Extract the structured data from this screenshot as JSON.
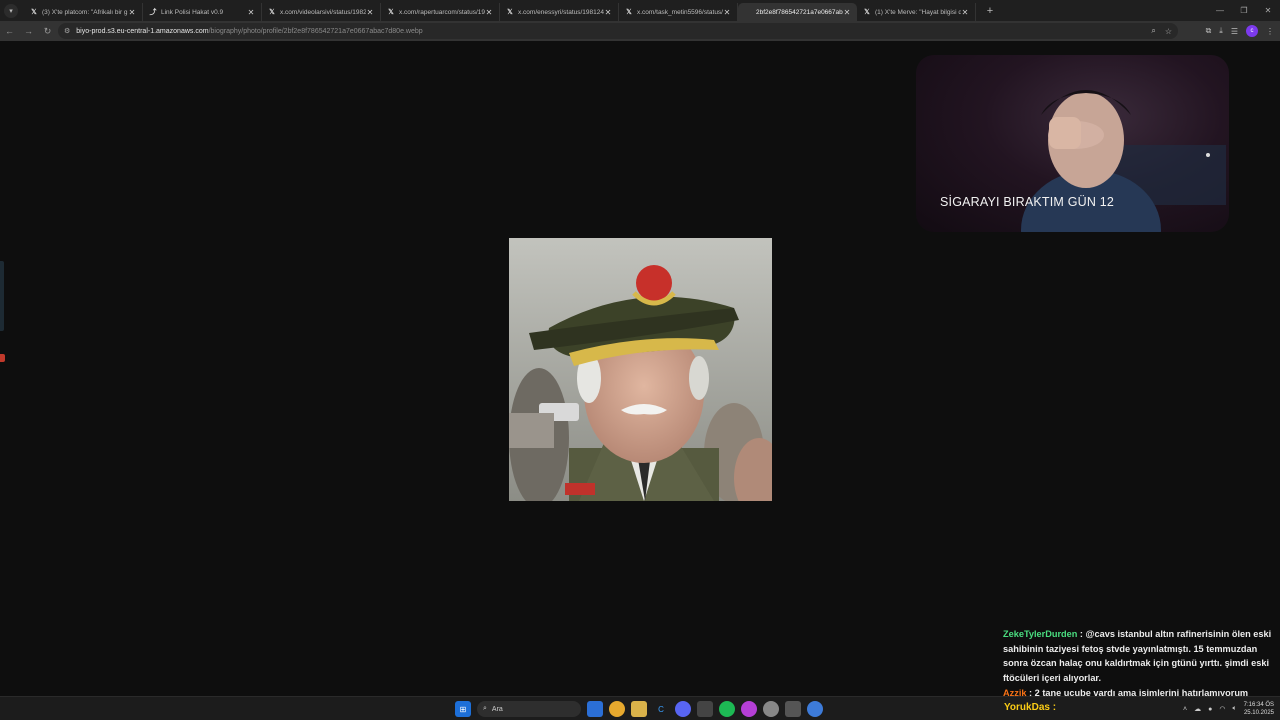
{
  "tabs": [
    {
      "label": "(3) X'te platcom: \"Afrikalı bir g",
      "icon": "x-logo-icon",
      "active": false
    },
    {
      "label": "Link Polisi Hakat v0.9",
      "icon": "link-icon",
      "active": false
    },
    {
      "label": "x.com/videolarsivi/status/1982",
      "icon": "x-logo-icon",
      "active": false
    },
    {
      "label": "x.com/rapertuarcom/status/19",
      "icon": "x-logo-icon",
      "active": false
    },
    {
      "label": "x.com/enessyri/status/1981242",
      "icon": "x-logo-icon",
      "active": false
    },
    {
      "label": "x.com/task_metin5596/status/1",
      "icon": "x-logo-icon",
      "active": false
    },
    {
      "label": "2bf2e8f786542721a7e0667abac",
      "icon": "none",
      "active": true
    },
    {
      "label": "(1) X'te Merve: \"Hayat bilgisi d",
      "icon": "x-logo-icon",
      "active": false
    }
  ],
  "address": {
    "host": "biyo-prod.s3.eu-central-1.amazonaws.com",
    "path": "/biography/photo/profile/2bf2e8f786542721a7e0667abac7d80e.webp"
  },
  "webcam": {
    "caption": "SİGARAYI BIRAKTIM GÜN 12"
  },
  "chat": [
    {
      "user": "ZekeTylerDurden",
      "separator": " : ",
      "text": "@cavs istanbul altın rafinerisinin ölen eski sahibinin taziyesi fetoş stvde yayınlatmıştı. 15 temmuzdan sonra özcan halaç onu kaldırtmak için gtünü yırttı. şimdi eski ftöcüleri içeri alıyorlar."
    },
    {
      "user": "Azzik",
      "separator": " : ",
      "text": "2 tane ucube vardı ama isimlerini hatırlamıyorum"
    }
  ],
  "overlay_user": "YorukDas :",
  "taskbar": {
    "search_label": "Ara",
    "time": "7:16:34 ÖS",
    "date": "25.10.2025"
  },
  "colors": {
    "tabbar": "#1f1f1f",
    "addressbar": "#333333",
    "page": "#0e0e0e",
    "chat_user_green": "#4ade80",
    "chat_user_orange": "#f97316",
    "chat_user_yellow": "#facc15"
  }
}
